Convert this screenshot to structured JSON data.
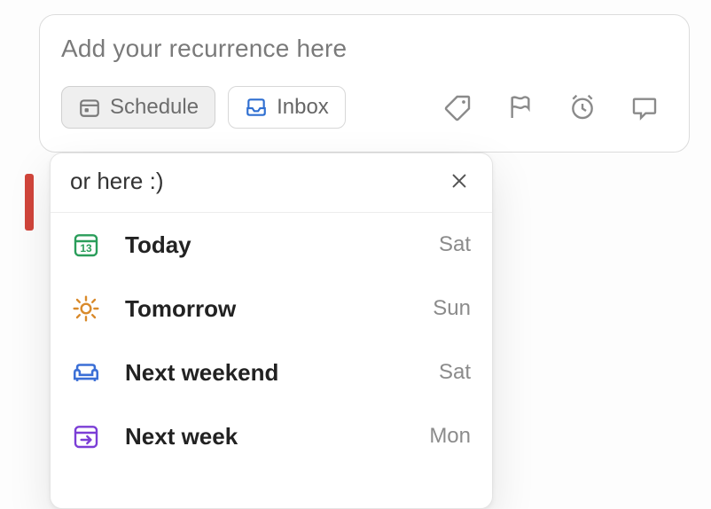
{
  "task": {
    "placeholder": "Add your recurrence here"
  },
  "toolbar": {
    "schedule_label": "Schedule",
    "inbox_label": "Inbox"
  },
  "popover": {
    "search_value": "or here :)",
    "options": [
      {
        "label": "Today",
        "day": "Sat"
      },
      {
        "label": "Tomorrow",
        "day": "Sun"
      },
      {
        "label": "Next weekend",
        "day": "Sat"
      },
      {
        "label": "Next week",
        "day": "Mon"
      }
    ],
    "today_number": "13"
  }
}
